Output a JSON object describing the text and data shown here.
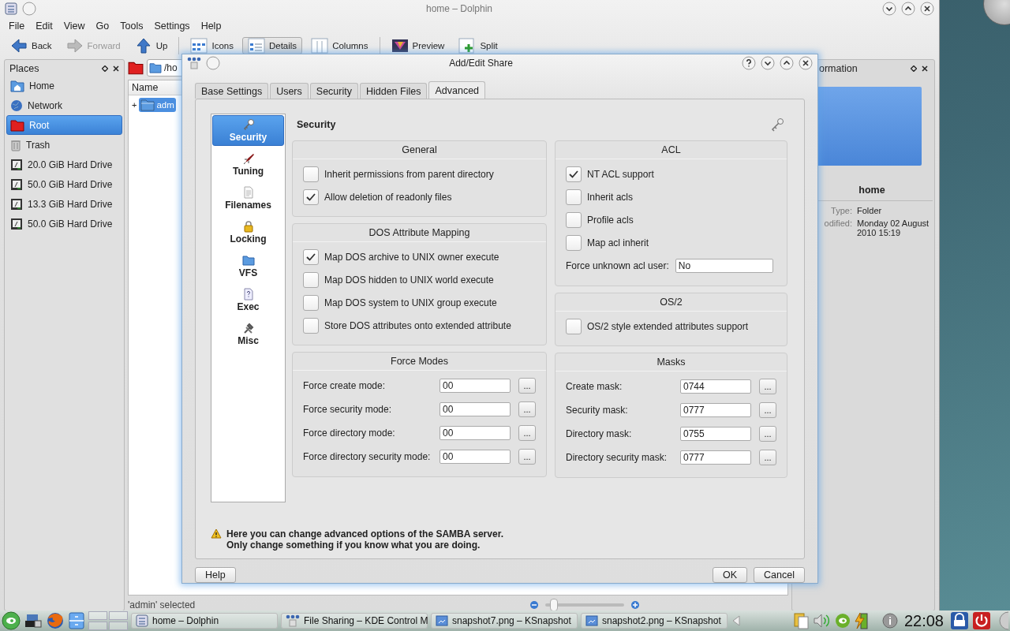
{
  "dolphin": {
    "title": "home – Dolphin",
    "menu": [
      "File",
      "Edit",
      "View",
      "Go",
      "Tools",
      "Settings",
      "Help"
    ],
    "toolbar": [
      {
        "label": "Back",
        "disabled": false,
        "selected": false
      },
      {
        "label": "Forward",
        "disabled": true,
        "selected": false
      },
      {
        "label": "Up",
        "disabled": false,
        "selected": false
      },
      {
        "label": "Icons",
        "disabled": false,
        "selected": false
      },
      {
        "label": "Details",
        "disabled": false,
        "selected": true
      },
      {
        "label": "Columns",
        "disabled": false,
        "selected": false
      },
      {
        "label": "Preview",
        "disabled": false,
        "selected": false
      },
      {
        "label": "Split",
        "disabled": false,
        "selected": false
      }
    ],
    "places": {
      "title": "Places",
      "items": [
        {
          "label": "Home",
          "selected": false
        },
        {
          "label": "Network",
          "selected": false
        },
        {
          "label": "Root",
          "selected": true
        },
        {
          "label": "Trash",
          "selected": false
        },
        {
          "label": "20.0 GiB Hard Drive",
          "selected": false
        },
        {
          "label": "50.0 GiB Hard Drive",
          "selected": false
        },
        {
          "label": "13.3 GiB Hard Drive",
          "selected": false
        },
        {
          "label": "50.0 GiB Hard Drive",
          "selected": false
        }
      ]
    },
    "location": "/ho",
    "columns": [
      "Name"
    ],
    "tree": [
      {
        "expander": "+",
        "label": "adm",
        "selected": true
      }
    ],
    "status": "'admin' selected",
    "zoom": {
      "level": 0.1
    },
    "info": {
      "title": "ormation",
      "name": "home",
      "rows": [
        {
          "label": "Type:",
          "value": "Folder"
        },
        {
          "label": "odified:",
          "value": "Monday 02 August 2010 15:19"
        }
      ]
    }
  },
  "dialog": {
    "title": "Add/Edit Share",
    "tabs": [
      {
        "label": "Base Settings",
        "selected": false
      },
      {
        "label": "Users",
        "selected": false
      },
      {
        "label": "Security",
        "selected": false
      },
      {
        "label": "Hidden Files",
        "selected": false
      },
      {
        "label": "Advanced",
        "selected": true
      }
    ],
    "sidebar": [
      {
        "label": "Security",
        "selected": true
      },
      {
        "label": "Tuning",
        "selected": false
      },
      {
        "label": "Filenames",
        "selected": false
      },
      {
        "label": "Locking",
        "selected": false
      },
      {
        "label": "VFS",
        "selected": false
      },
      {
        "label": "Exec",
        "selected": false
      },
      {
        "label": "Misc",
        "selected": false
      }
    ],
    "page_title": "Security",
    "columns": [
      [
        {
          "title": "General",
          "rows": [
            {
              "kind": "checkbox",
              "label": "Inherit permissions from parent directory",
              "checked": false
            },
            {
              "kind": "checkbox",
              "label": "Allow deletion of readonly files",
              "checked": true
            }
          ]
        },
        {
          "title": "DOS Attribute Mapping",
          "rows": [
            {
              "kind": "checkbox",
              "label": "Map DOS archive to UNIX owner execute",
              "checked": true
            },
            {
              "kind": "checkbox",
              "label": "Map DOS hidden to UNIX world execute",
              "checked": false
            },
            {
              "kind": "checkbox",
              "label": "Map DOS system to UNIX group execute",
              "checked": false
            },
            {
              "kind": "checkbox",
              "label": "Store DOS attributes onto extended attribute",
              "checked": false
            }
          ]
        },
        {
          "title": "Force Modes",
          "rows": [
            {
              "kind": "mode",
              "label": "Force create mode:",
              "value": "00",
              "button": "..."
            },
            {
              "kind": "mode",
              "label": "Force security mode:",
              "value": "00",
              "button": "..."
            },
            {
              "kind": "mode",
              "label": "Force directory mode:",
              "value": "00",
              "button": "..."
            },
            {
              "kind": "mode",
              "label": "Force directory security mode:",
              "value": "00",
              "button": "..."
            }
          ]
        }
      ],
      [
        {
          "title": "ACL",
          "rows": [
            {
              "kind": "checkbox",
              "label": "NT ACL support",
              "checked": true
            },
            {
              "kind": "checkbox",
              "label": "Inherit acls",
              "checked": false
            },
            {
              "kind": "checkbox",
              "label": "Profile acls",
              "checked": false
            },
            {
              "kind": "checkbox",
              "label": "Map acl inherit",
              "checked": false
            },
            {
              "kind": "text",
              "label": "Force unknown acl user:",
              "value": "No"
            }
          ]
        },
        {
          "title": "OS/2",
          "rows": [
            {
              "kind": "checkbox",
              "label": "OS/2 style extended attributes support",
              "checked": false
            }
          ]
        },
        {
          "title": "Masks",
          "rows": [
            {
              "kind": "mode",
              "label": "Create mask:",
              "value": "0744",
              "button": "..."
            },
            {
              "kind": "mode",
              "label": "Security mask:",
              "value": "0777",
              "button": "..."
            },
            {
              "kind": "mode",
              "label": "Directory mask:",
              "value": "0755",
              "button": "..."
            },
            {
              "kind": "mode",
              "label": "Directory security mask:",
              "value": "0777",
              "button": "..."
            }
          ]
        }
      ]
    ],
    "warning": [
      "Here you can change advanced options of the SAMBA server.",
      "Only change something if you know what you are doing."
    ],
    "buttons": {
      "help": "Help",
      "ok": "OK",
      "cancel": "Cancel"
    }
  },
  "taskbar": {
    "tasks": [
      "home – Dolphin",
      "File Sharing – KDE Control M",
      "snapshot7.png – KSnapshot",
      "snapshot2.png – KSnapshot"
    ],
    "clock": "22:08"
  }
}
